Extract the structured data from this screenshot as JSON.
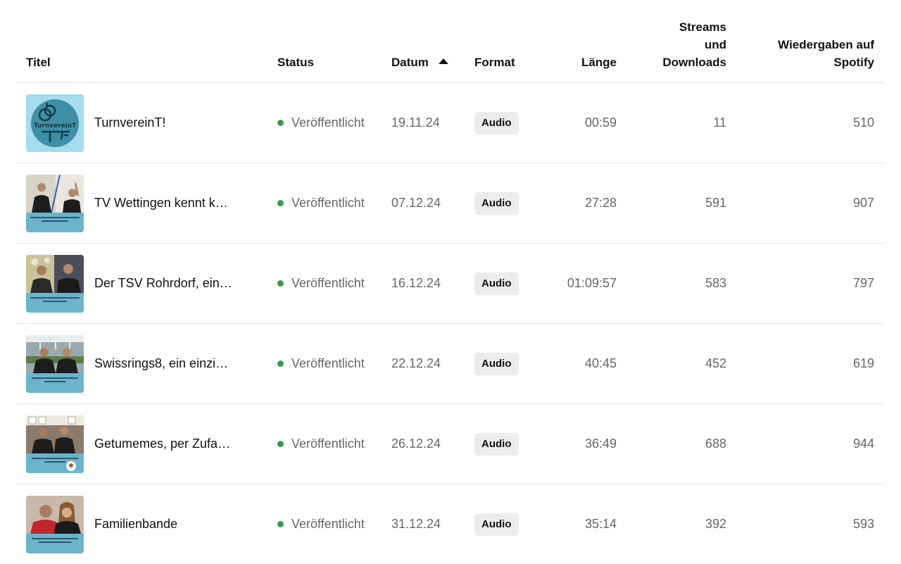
{
  "columns": {
    "title": "Titel",
    "status": "Status",
    "date": "Datum",
    "format": "Format",
    "length": "Länge",
    "streams_line1": "Streams",
    "streams_line2": "und",
    "streams_line3": "Downloads",
    "spotify_line1": "Wiedergaben auf",
    "spotify_line2": "Spotify"
  },
  "sort": {
    "column": "date",
    "direction": "ascending"
  },
  "colors": {
    "status_dot": "#3a9a4a",
    "thumb_bg": "#6cb3cc",
    "badge_bg": "#ececec"
  },
  "episodes": [
    {
      "title": "TurnvereinT!",
      "status": "Veröffentlicht",
      "date": "19.11.24",
      "format": "Audio",
      "length": "00:59",
      "streams": "11",
      "spotify": "510",
      "thumb_text": "TurnvereinT"
    },
    {
      "title": "TV Wettingen kennt k…",
      "status": "Veröffentlicht",
      "date": "07.12.24",
      "format": "Audio",
      "length": "27:28",
      "streams": "591",
      "spotify": "907"
    },
    {
      "title": "Der TSV Rohrdorf, ein…",
      "status": "Veröffentlicht",
      "date": "16.12.24",
      "format": "Audio",
      "length": "01:09:57",
      "streams": "583",
      "spotify": "797"
    },
    {
      "title": "Swissrings8, ein einzi…",
      "status": "Veröffentlicht",
      "date": "22.12.24",
      "format": "Audio",
      "length": "40:45",
      "streams": "452",
      "spotify": "619"
    },
    {
      "title": "Getumemes, per Zufa…",
      "status": "Veröffentlicht",
      "date": "26.12.24",
      "format": "Audio",
      "length": "36:49",
      "streams": "688",
      "spotify": "944"
    },
    {
      "title": "Familienbande",
      "status": "Veröffentlicht",
      "date": "31.12.24",
      "format": "Audio",
      "length": "35:14",
      "streams": "392",
      "spotify": "593"
    }
  ]
}
